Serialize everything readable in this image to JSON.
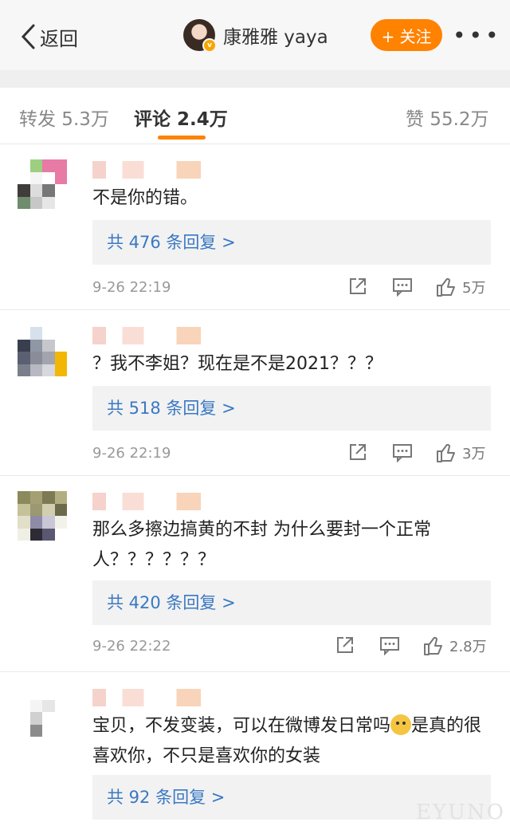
{
  "header": {
    "back_label": "返回",
    "username": "康雅雅 yaya",
    "follow_label": "+ 关注",
    "more_label": "•••",
    "verified_icon": "v-badge-icon"
  },
  "tabs": [
    {
      "label": "转发 5.3万",
      "active": false
    },
    {
      "label": "评论 2.4万",
      "active": true
    },
    {
      "label": "赞 55.2万",
      "active": false
    }
  ],
  "accent_color": "#ff8200",
  "link_color": "#3a78c3",
  "comments": [
    {
      "text": "不是你的错。",
      "replies": "共 476 条回复 >",
      "time": "9-26 22:19",
      "likes": "5万"
    },
    {
      "text": "？我不李姐？现在是不是2021？？？",
      "replies": "共 518 条回复 >",
      "time": "9-26 22:19",
      "likes": "3万"
    },
    {
      "text": "那么多擦边搞黄的不封 为什么要封一个正常人？？？？？？",
      "replies": "共 420 条回复 >",
      "time": "9-26 22:22",
      "likes": "2.8万"
    },
    {
      "text_a": "宝贝，不发变装，可以在微博发日常吗",
      "text_b": "是真的很喜欢你，不只是喜欢你的女装",
      "replies": "共 92 条回复 >",
      "emoji_icon": "doge-emoji-icon"
    }
  ],
  "watermark": "EYUNO"
}
